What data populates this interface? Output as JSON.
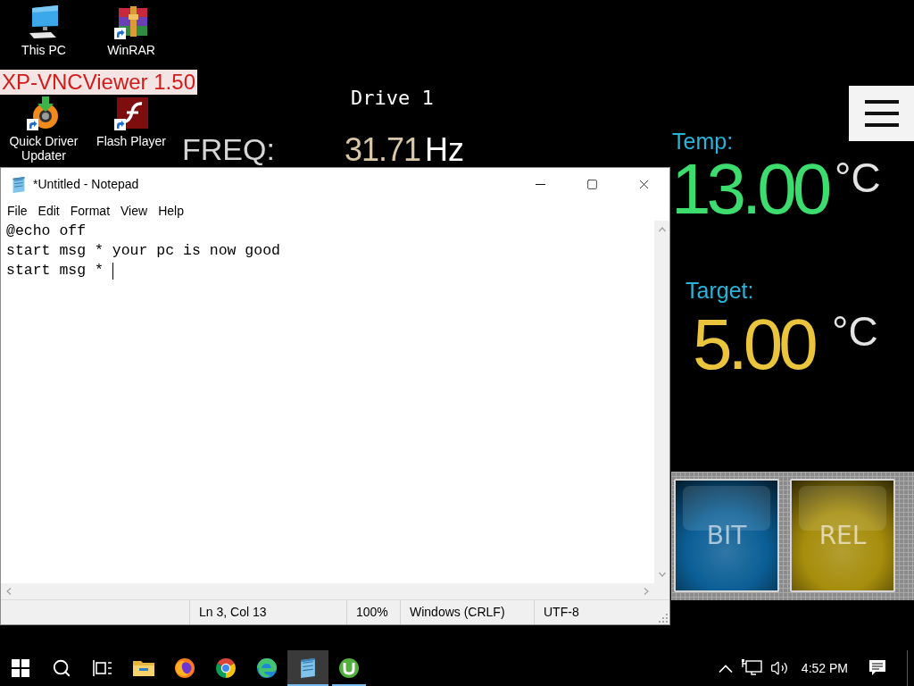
{
  "vnc_screen": {
    "banner": "XP-VNCViewer 1.50",
    "title": "Drive 1",
    "freq": {
      "label": "FREQ:",
      "value": "31.71",
      "unit": "Hz"
    },
    "temp": {
      "label": "Temp:",
      "value": "13.00",
      "unit": "°C"
    },
    "target": {
      "label": "Target:",
      "value": "5.00",
      "unit": "°C"
    },
    "buttons": [
      {
        "label": "BIT",
        "color": "#0b5f96"
      },
      {
        "label": "REL",
        "color": "#a68d0c"
      }
    ]
  },
  "desktop_icons": [
    {
      "kind": "computer",
      "label": "This PC",
      "shortcut": false
    },
    {
      "kind": "archive",
      "label": "WinRAR",
      "shortcut": true
    },
    {
      "kind": "driver-tool",
      "label": "Quick Driver Updater",
      "shortcut": true
    },
    {
      "kind": "flash",
      "label": "Flash Player",
      "shortcut": true
    }
  ],
  "notepad": {
    "title": "*Untitled - Notepad",
    "menu": [
      "File",
      "Edit",
      "Format",
      "View",
      "Help"
    ],
    "lines": [
      "@echo off",
      "start msg * your pc is now good",
      "start msg * "
    ],
    "status": [
      "Ln 3, Col 13",
      "100%",
      "Windows (CRLF)",
      "UTF-8"
    ]
  },
  "taskbar": {
    "system_buttons": [
      {
        "kind": "start"
      },
      {
        "kind": "search"
      },
      {
        "kind": "task-view"
      }
    ],
    "apps": [
      {
        "kind": "folder",
        "running": false,
        "selected": false
      },
      {
        "kind": "firefox",
        "running": false,
        "selected": false
      },
      {
        "kind": "chrome",
        "running": false,
        "selected": false
      },
      {
        "kind": "edge",
        "running": false,
        "selected": false
      },
      {
        "kind": "notepad",
        "running": true,
        "selected": true
      },
      {
        "kind": "utorrent",
        "running": true,
        "selected": false
      }
    ],
    "tray": [
      {
        "kind": "chevron"
      },
      {
        "kind": "network"
      },
      {
        "kind": "volume"
      }
    ],
    "clock": "4:52 PM"
  }
}
